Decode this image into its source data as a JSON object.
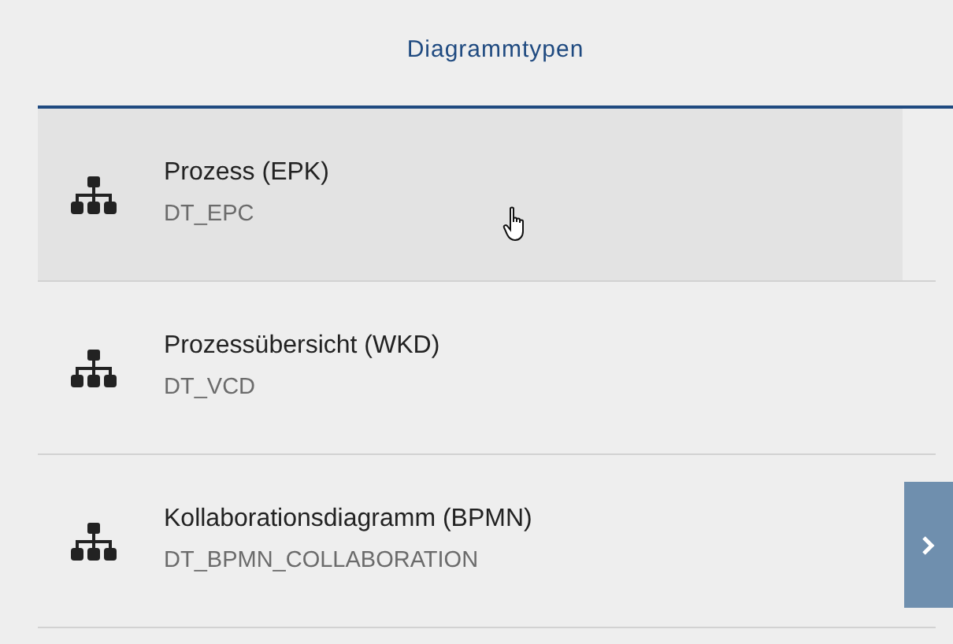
{
  "panel": {
    "title": "Diagrammtypen"
  },
  "items": [
    {
      "name": "Prozess (EPK)",
      "code": "DT_EPC",
      "hovered": true
    },
    {
      "name": "Prozessübersicht (WKD)",
      "code": "DT_VCD",
      "hovered": false
    },
    {
      "name": "Kollaborationsdiagramm (BPMN)",
      "code": "DT_BPMN_COLLABORATION",
      "hovered": false
    }
  ]
}
